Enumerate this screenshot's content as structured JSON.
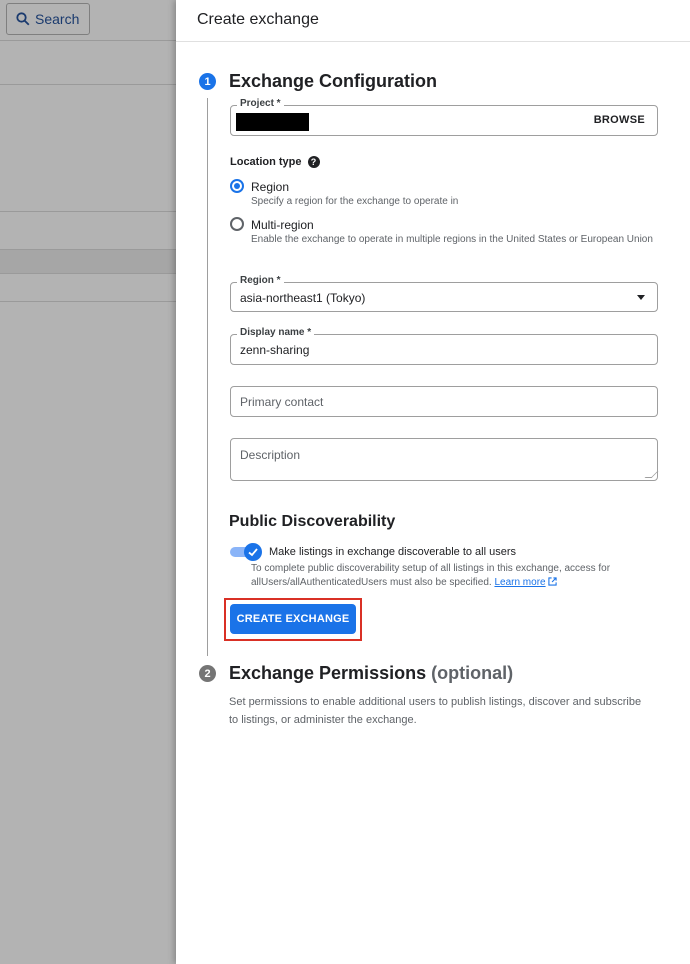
{
  "background": {
    "search_label": "Search"
  },
  "panel": {
    "title": "Create exchange"
  },
  "step1": {
    "number": "1",
    "title": "Exchange Configuration",
    "project": {
      "label": "Project *",
      "browse": "BROWSE"
    },
    "location_type": {
      "label": "Location type",
      "help": "?",
      "options": [
        {
          "title": "Region",
          "desc": "Specify a region for the exchange to operate in",
          "selected": true
        },
        {
          "title": "Multi-region",
          "desc": "Enable the exchange to operate in multiple regions in the United States or European Union",
          "selected": false
        }
      ]
    },
    "region": {
      "label": "Region *",
      "value": "asia-northeast1 (Tokyo)"
    },
    "display_name": {
      "label": "Display name *",
      "value": "zenn-sharing"
    },
    "primary_contact": {
      "placeholder": "Primary contact"
    },
    "description": {
      "placeholder": "Description"
    },
    "discoverability": {
      "title": "Public Discoverability",
      "toggle_label": "Make listings in exchange discoverable to all users",
      "toggle_on": true,
      "desc": "To complete public discoverability setup of all listings in this exchange, access for allUsers/allAuthenticatedUsers must also be specified.",
      "learn_more": "Learn more"
    },
    "create_button": "CREATE EXCHANGE"
  },
  "step2": {
    "number": "2",
    "title": "Exchange Permissions",
    "optional": "(optional)",
    "desc": "Set permissions to enable additional users to publish listings, discover and subscribe to listings, or administer the exchange."
  },
  "colors": {
    "accent": "#1a73e8",
    "highlight": "#d93025"
  }
}
